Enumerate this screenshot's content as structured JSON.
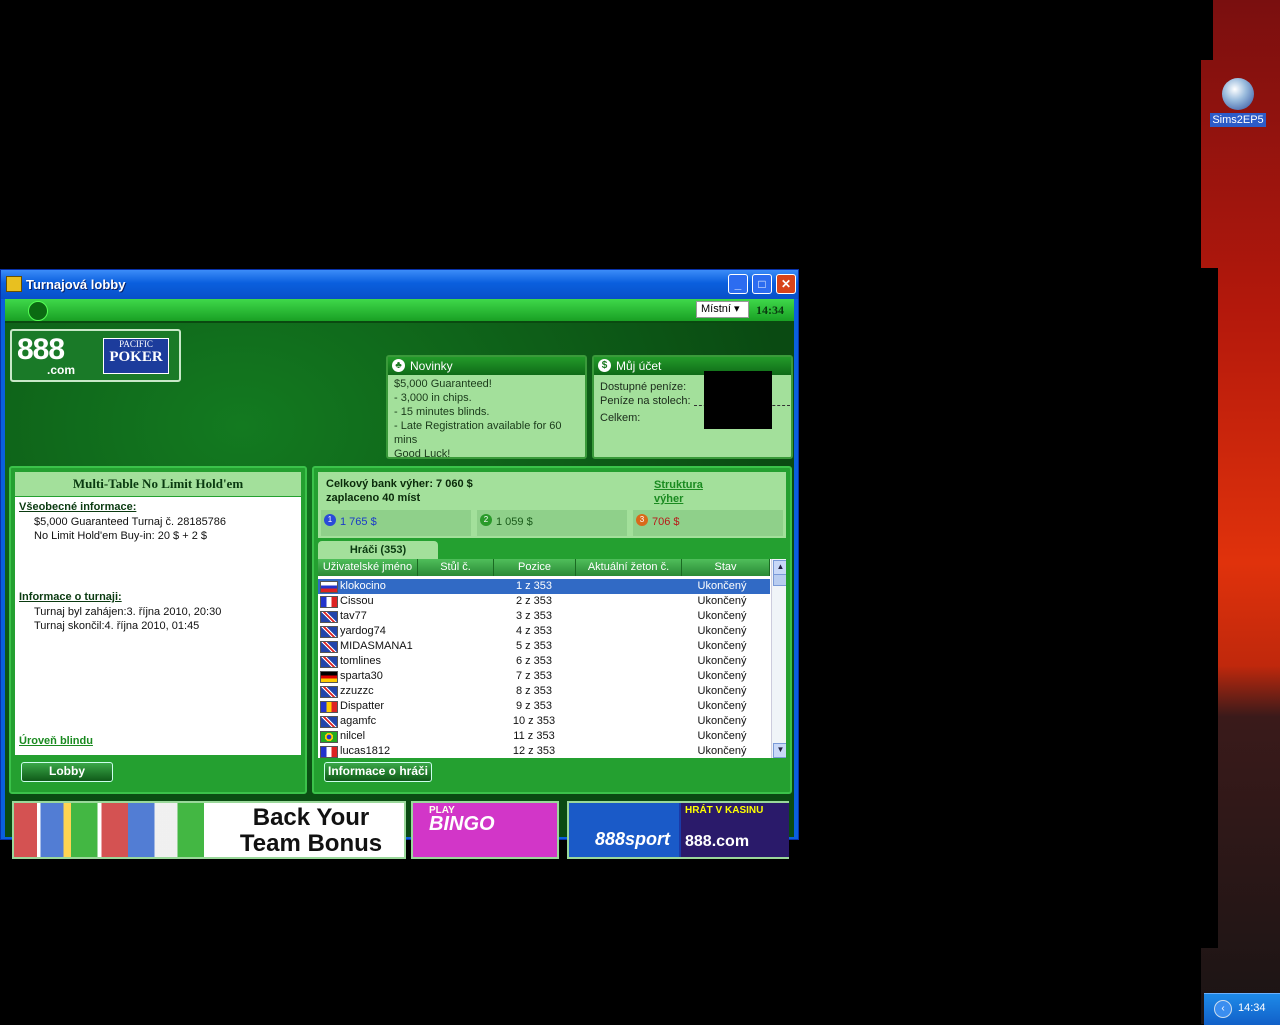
{
  "desktop": {
    "icon_label": "Sims2EP5",
    "clock": "14:34"
  },
  "window": {
    "title": "Turnajová lobby",
    "language": "Místní",
    "clock": "14:34",
    "brand": {
      "logo": "888",
      "logo_sub": ".com",
      "poker_top": "PACIFIC",
      "poker_main": "POKER"
    },
    "news": {
      "title": "Novinky",
      "lines": [
        "$5,000 Guaranteed!",
        "- 3,000 in chips.",
        "- 15 minutes blinds.",
        "- Late Registration available for 60 mins",
        "Good Luck!"
      ]
    },
    "account": {
      "title": "Můj účet",
      "available": "Dostupné peníze:",
      "at_tables": "Peníze na stolech:",
      "total": "Celkem:"
    },
    "tournament": {
      "title": "Multi-Table No Limit  Hold'em",
      "general_heading": "Všeobecné informace:",
      "general_lines": [
        "$5,000 Guaranteed Turnaj č. 28185786",
        "No Limit Hold'em Buy-in: 20 $ + 2 $"
      ],
      "info_heading": "Informace o turnaji:",
      "info_lines": [
        "Turnaj byl zahájen:3. října 2010, 20:30",
        "Turnaj skončil:4. října 2010, 01:45"
      ],
      "blind_link": "Úroveň blindu",
      "lobby_button": "Lobby"
    },
    "prizes": {
      "total": "Celkový bank výher: 7 060 $",
      "paid": "zaplaceno 40 míst",
      "structure_link": "Struktura výher",
      "places": [
        {
          "rank": "1",
          "amount": "1 765 $",
          "color": "#1a3ac8"
        },
        {
          "rank": "2",
          "amount": "1 059 $",
          "color": "#1a5a1a"
        },
        {
          "rank": "3",
          "amount": "706 $",
          "color": "#b81a1a"
        }
      ]
    },
    "players_tab": "Hráči (353)",
    "columns": [
      "Uživatelské jméno",
      "Stůl č.",
      "Pozice",
      "Aktuální žeton č.",
      "Stav"
    ],
    "players": [
      {
        "name": "klokocino",
        "pos": "1 z 353",
        "status": "Ukončený",
        "flag": "sk"
      },
      {
        "name": "Cissou",
        "pos": "2 z 353",
        "status": "Ukončený",
        "flag": "fr"
      },
      {
        "name": "tav77",
        "pos": "3 z 353",
        "status": "Ukončený",
        "flag": "gb"
      },
      {
        "name": "yardog74",
        "pos": "4 z 353",
        "status": "Ukončený",
        "flag": "gb"
      },
      {
        "name": "MIDASMANA1",
        "pos": "5 z 353",
        "status": "Ukončený",
        "flag": "gb"
      },
      {
        "name": "tomlines",
        "pos": "6 z 353",
        "status": "Ukončený",
        "flag": "gb"
      },
      {
        "name": "sparta30",
        "pos": "7 z 353",
        "status": "Ukončený",
        "flag": "de"
      },
      {
        "name": "zzuzzc",
        "pos": "8 z 353",
        "status": "Ukončený",
        "flag": "gb"
      },
      {
        "name": "Dispatter",
        "pos": "9 z 353",
        "status": "Ukončený",
        "flag": "md"
      },
      {
        "name": "agamfc",
        "pos": "10 z 353",
        "status": "Ukončený",
        "flag": "gb"
      },
      {
        "name": "nilcel",
        "pos": "11 z 353",
        "status": "Ukončený",
        "flag": "br"
      },
      {
        "name": "lucas1812",
        "pos": "12 z 353",
        "status": "Ukončený",
        "flag": "fr"
      }
    ],
    "player_info_button": "Informace o hráči",
    "banners": {
      "team_bonus": "Back Your Team Bonus",
      "bingo_play": "PLAY",
      "bingo": "BINGO",
      "sport": "888sport",
      "casino_top": "HRÁT V KASINU",
      "casino": "888.com"
    }
  }
}
